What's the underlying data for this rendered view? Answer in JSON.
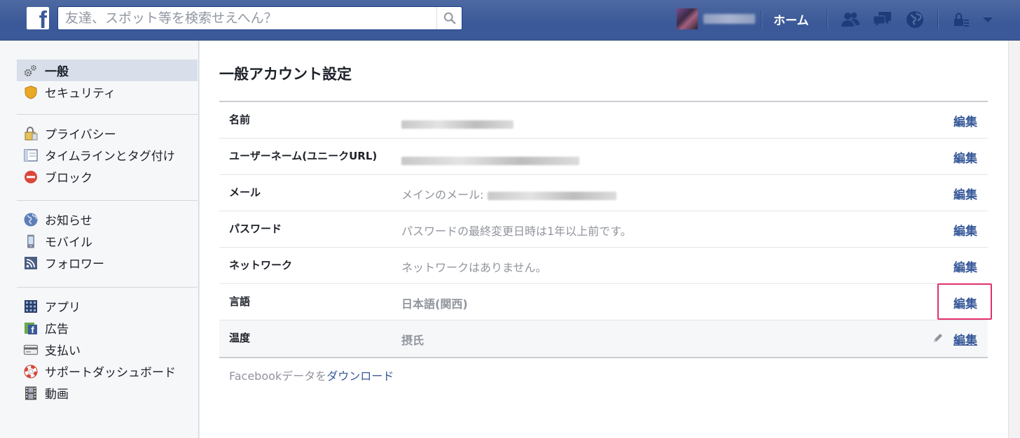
{
  "header": {
    "logo": "f",
    "search_placeholder": "友達、スポット等を検索せえへん？",
    "home_label": "ホーム",
    "icons": [
      "friends-icon",
      "messages-icon",
      "notifications-globe-icon",
      "privacy-lock-icon",
      "dropdown-arrow-icon"
    ]
  },
  "sidebar": {
    "groups": [
      [
        {
          "label": "一般",
          "icon": "gears-icon",
          "active": true
        },
        {
          "label": "セキュリティ",
          "icon": "shield-icon"
        }
      ],
      [
        {
          "label": "プライバシー",
          "icon": "padlock-icon"
        },
        {
          "label": "タイムラインとタグ付け",
          "icon": "timeline-icon"
        },
        {
          "label": "ブロック",
          "icon": "block-icon"
        }
      ],
      [
        {
          "label": "お知らせ",
          "icon": "globe-icon"
        },
        {
          "label": "モバイル",
          "icon": "mobile-icon"
        },
        {
          "label": "フォロワー",
          "icon": "rss-icon"
        }
      ],
      [
        {
          "label": "アプリ",
          "icon": "apps-icon"
        },
        {
          "label": "広告",
          "icon": "ads-icon"
        },
        {
          "label": "支払い",
          "icon": "card-icon"
        },
        {
          "label": "サポートダッシュボード",
          "icon": "lifebuoy-icon"
        },
        {
          "label": "動画",
          "icon": "film-icon"
        }
      ]
    ]
  },
  "main": {
    "title": "一般アカウント設定",
    "rows": [
      {
        "key": "名前",
        "value": "",
        "edit": "編集"
      },
      {
        "key": "ユーザーネーム(ユニークURL)",
        "value": "",
        "edit": "編集"
      },
      {
        "key": "メール",
        "value": "メインのメール:",
        "edit": "編集"
      },
      {
        "key": "パスワード",
        "value": "パスワードの最終変更日時は1年以上前です。",
        "edit": "編集"
      },
      {
        "key": "ネットワーク",
        "value": "ネットワークはありません。",
        "edit": "編集"
      },
      {
        "key": "言語",
        "value": "日本語(関西)",
        "edit": "編集"
      },
      {
        "key": "温度",
        "value": "摂氏",
        "edit": "編集"
      }
    ],
    "download_prefix": "Facebookデータを",
    "download_link": "ダウンロード"
  },
  "colors": {
    "brand": "#3b5998",
    "link": "#365899",
    "highlight": "#e0306e"
  }
}
